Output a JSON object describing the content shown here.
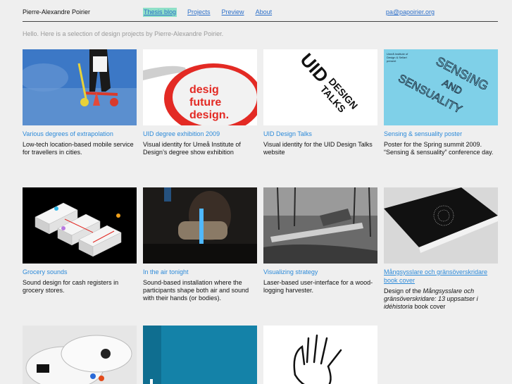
{
  "header": {
    "site_name": "Pierre-Alexandre Poirier",
    "nav": [
      "Thesis blog",
      "Projects",
      "Preview",
      "About"
    ],
    "email": "pa@papoirier.org"
  },
  "intro": "Hello. Here is a selection of design projects by Pierre-Alexandre Poirier.",
  "projects": [
    {
      "title": "Various degrees of extrapolation",
      "desc": "Low-tech location-based mobile service for travellers in cities."
    },
    {
      "title": "UID degree exhibition 2009",
      "desc": "Visual identity for Umeå Institute of Design’s degree show exhibition",
      "thumb_text": [
        "desig",
        "future",
        "design."
      ]
    },
    {
      "title": "UID Design Talks",
      "desc": "Visual identity for the UID Design Talks website",
      "thumb_text": [
        "UID",
        "DESIGN",
        "TALKS"
      ]
    },
    {
      "title": "Sensing & sensuality poster",
      "desc": "Poster for the Spring summit 2009. “Sensing & sensuality” conference day.",
      "thumb_text": [
        "Umeå Institute of",
        "Design & Sellart",
        "present",
        "SENSING",
        "AND",
        "SENSUALITY"
      ]
    },
    {
      "title": "Grocery sounds",
      "desc": "Sound design for cash registers in grocery stores."
    },
    {
      "title": "In the air tonight",
      "desc": "Sound-based installation where the participants shape both air and sound with their hands (or bodies)."
    },
    {
      "title": "Visualizing strategy",
      "desc": "Laser-based user-interface for a wood-logging harvester."
    },
    {
      "title": "Mångsysslare och gränsöverskridare book cover",
      "desc_parts": [
        "Design of the ",
        "Mångsysslare och gränsöverskridare: 13 uppsatser i idéhistoria",
        " book cover"
      ]
    },
    {
      "title": "",
      "desc": ""
    },
    {
      "title": "",
      "desc": ""
    },
    {
      "title": "",
      "desc": ""
    }
  ]
}
